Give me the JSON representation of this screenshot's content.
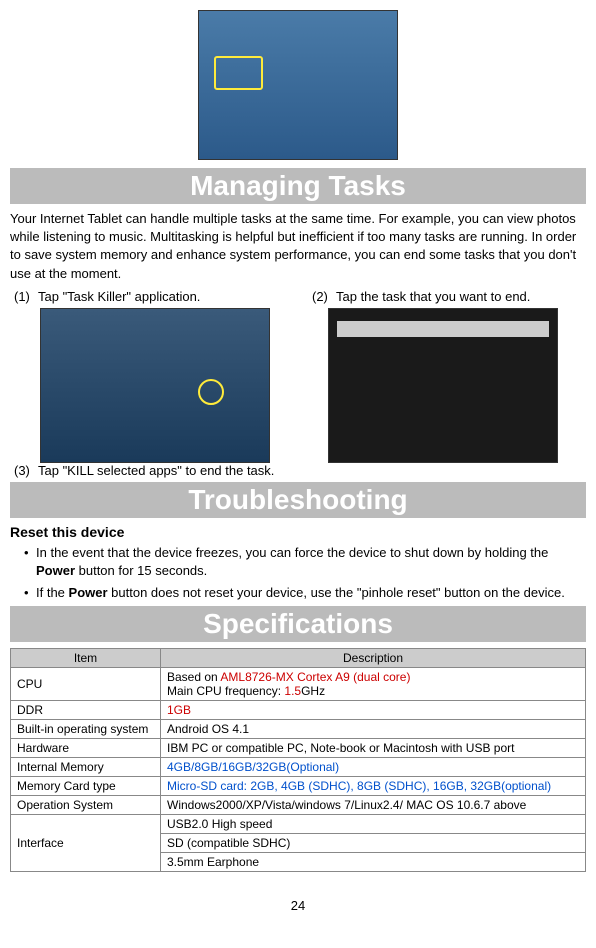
{
  "sections": {
    "managing": "Managing Tasks",
    "troubleshooting": "Troubleshooting",
    "specifications": "Specifications"
  },
  "intro": "Your Internet Tablet can handle multiple tasks at the same time. For example, you can view photos while listening to music. Multitasking is helpful but inefficient if too many tasks are running. In order to save system memory and enhance system performance, you can end some tasks that you don't use at the moment.",
  "steps": {
    "s1num": "(1)",
    "s1text": "Tap \"Task Killer\" application.",
    "s2num": "(2)",
    "s2text": "Tap the task that you want to end.",
    "s3num": "(3)",
    "s3text": "Tap \"KILL selected apps\" to end the task."
  },
  "reset": {
    "heading": "Reset this device",
    "b1a": "In the event that the device freezes, you can force the device to shut down by holding the ",
    "b1b": "Power",
    "b1c": " button for 15 seconds.",
    "b2a": "If the ",
    "b2b": "Power",
    "b2c": " button does not reset your device, use the \"pinhole reset\" button on the device."
  },
  "table": {
    "hItem": "Item",
    "hDesc": "Description",
    "cpu": "CPU",
    "cpu_d1a": "Based on ",
    "cpu_d1b": "AML8726-MX Cortex A9 (dual core)",
    "cpu_d2a": "Main CPU frequency: ",
    "cpu_d2b": "1.5",
    "cpu_d2c": "GHz",
    "ddr": "DDR",
    "ddr_d": "1GB",
    "os": "Built-in operating system",
    "os_d": "Android OS 4.1",
    "hw": "Hardware",
    "hw_d": "IBM PC or compatible PC, Note-book or Macintosh with USB port",
    "im": "Internal Memory",
    "im_d": "4GB/8GB/16GB/32GB(Optional)",
    "mc": "Memory Card type",
    "mc_d": "Micro-SD card: 2GB, 4GB (SDHC), 8GB (SDHC), 16GB, 32GB(optional)",
    "osys": "Operation System",
    "osys_d": "Windows2000/XP/Vista/windows 7/Linux2.4/ MAC OS 10.6.7 above",
    "iface": "Interface",
    "iface_d1": "USB2.0 High speed",
    "iface_d2": "SD (compatible SDHC)",
    "iface_d3": "3.5mm Earphone"
  },
  "page": "24"
}
